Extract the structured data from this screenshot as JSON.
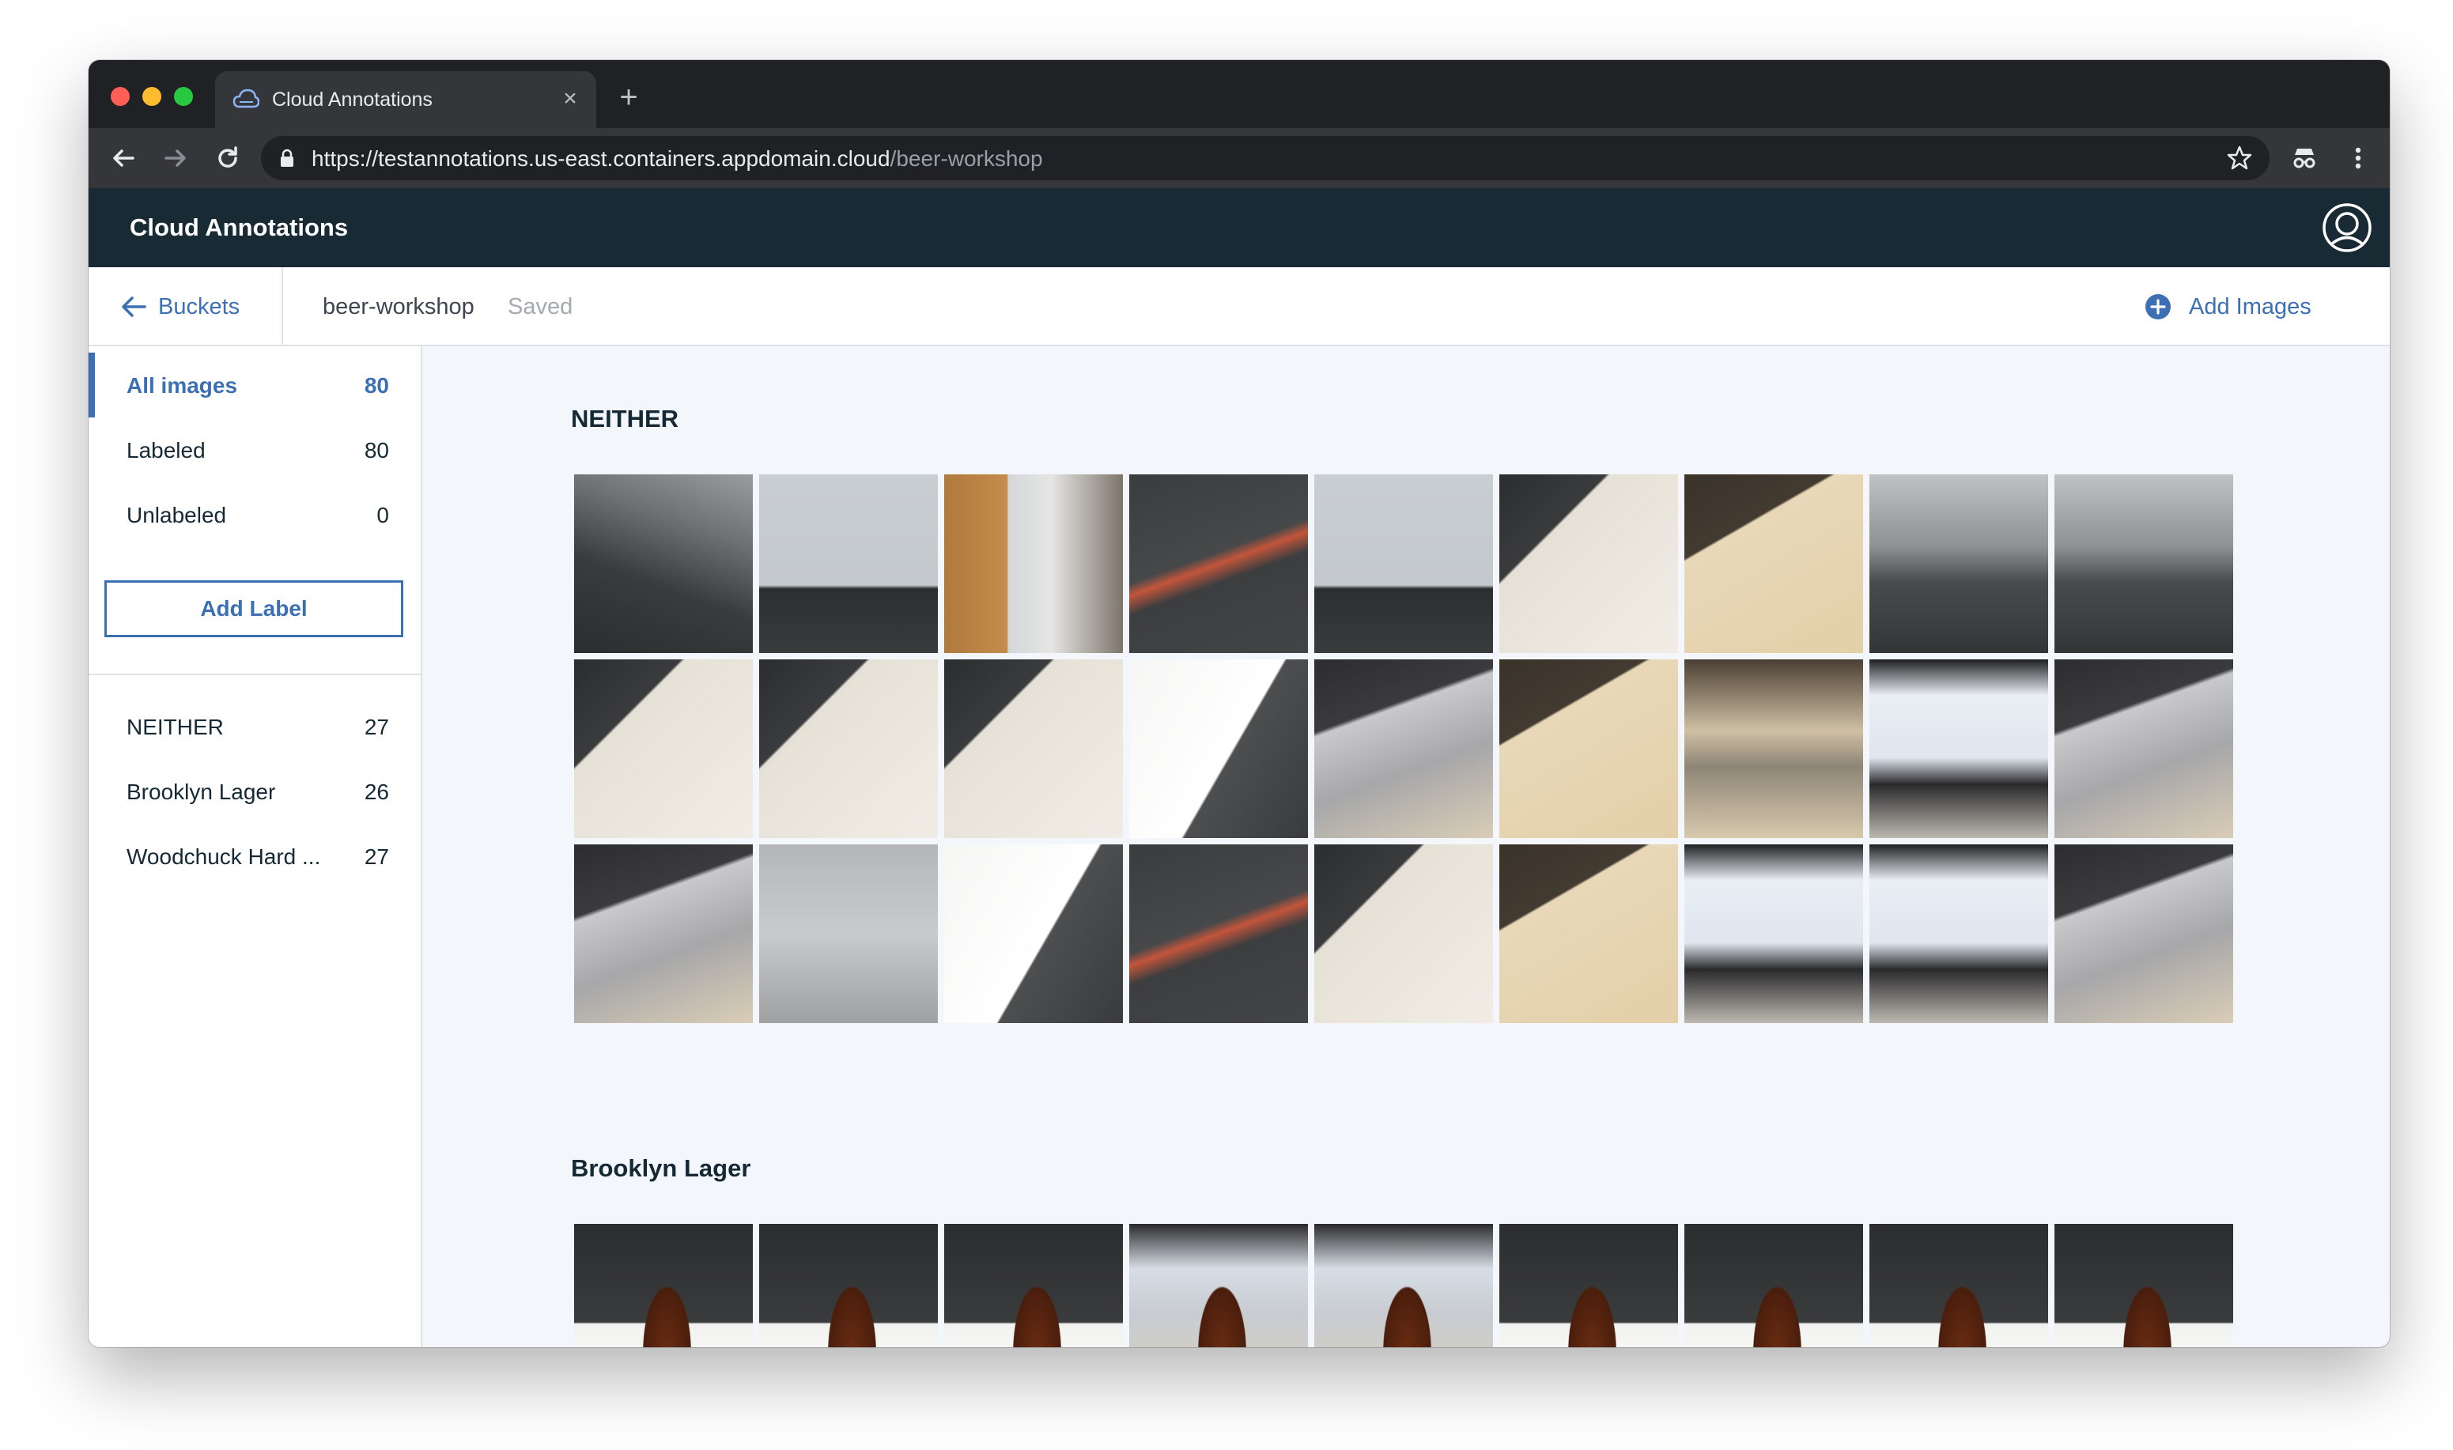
{
  "browser": {
    "tab_title": "Cloud Annotations",
    "url_host": "https://testannotations.us-east.containers.appdomain.cloud",
    "url_path": "/beer-workshop"
  },
  "app": {
    "title": "Cloud Annotations"
  },
  "subheader": {
    "back_label": "Buckets",
    "bucket_name": "beer-workshop",
    "status": "Saved",
    "add_images_label": "Add Images"
  },
  "sidebar": {
    "filters": [
      {
        "label": "All images",
        "count": "80"
      },
      {
        "label": "Labeled",
        "count": "80"
      },
      {
        "label": "Unlabeled",
        "count": "0"
      }
    ],
    "add_label_button": "Add Label",
    "labels": [
      {
        "label": "NEITHER",
        "count": "27"
      },
      {
        "label": "Brooklyn Lager",
        "count": "26"
      },
      {
        "label": "Woodchuck Hard ...",
        "count": "27"
      }
    ]
  },
  "sections": [
    {
      "title": "NEITHER",
      "image_count_shown": 27
    },
    {
      "title": "Brooklyn Lager",
      "image_count_shown": 9
    }
  ],
  "colors": {
    "accent": "#3d70b2",
    "header_bg": "#182a34",
    "chrome_dark": "#202124",
    "page_bg": "#f3f6fa"
  }
}
